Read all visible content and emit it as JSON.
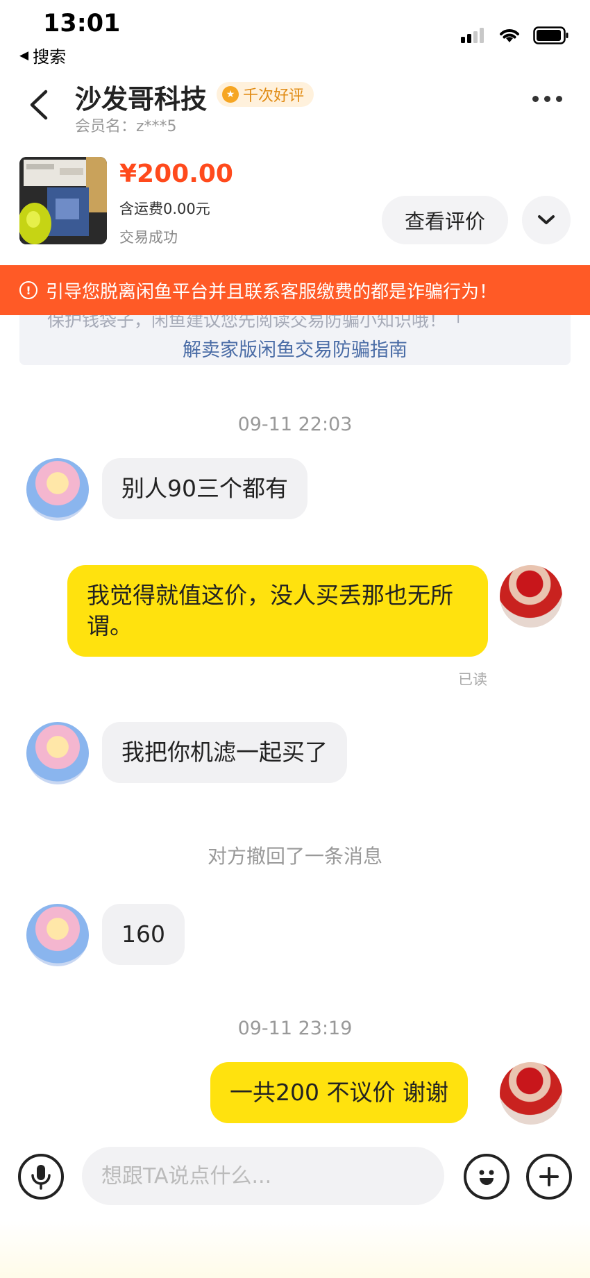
{
  "status_bar": {
    "time": "13:01",
    "back_app_label": "搜索",
    "back_arrow_glyph": "◀",
    "icons": [
      "cellular-signal-icon",
      "wifi-icon",
      "battery-icon"
    ]
  },
  "header": {
    "shop_name": "沙发哥科技",
    "rating_badge": "千次好评",
    "member_label": "会员名：z***5",
    "more_icon": "more-dots-icon",
    "back_icon": "chevron-left-icon"
  },
  "product": {
    "price": "¥200.00",
    "shipping": "含运费0.00元",
    "status": "交易成功",
    "review_button": "查看评价",
    "expand_icon": "chevron-down-icon"
  },
  "warning": {
    "text": "引导您脱离闲鱼平台并且联系客服缴费的都是诈骗行为！",
    "icon_glyph": "!",
    "color": "#ff5a26"
  },
  "notice": {
    "partial_text": "保护钱袋子，闲鱼建议您先阅读交易防骗小知识哦！「",
    "link_text": "解卖家版闲鱼交易防骗指南"
  },
  "chat": {
    "timestamp_1": "09-11 22:03",
    "msg_1": "别人90三个都有",
    "msg_2": "我觉得就值这价，没人买丢那也无所谓。",
    "msg_2_status": "已读",
    "msg_3": "我把你机滤一起买了",
    "system_recall": "对方撤回了一条消息",
    "msg_4": "160",
    "timestamp_2": "09-11 23:19",
    "msg_5": "一共200 不议价 谢谢"
  },
  "input_bar": {
    "placeholder": "想跟TA说点什么...",
    "icons": [
      "microphone-icon",
      "emoji-icon",
      "plus-icon"
    ]
  },
  "colors": {
    "accent_yellow": "#ffe20e",
    "price_red": "#ff4a1c",
    "badge_orange": "#e08a12"
  }
}
